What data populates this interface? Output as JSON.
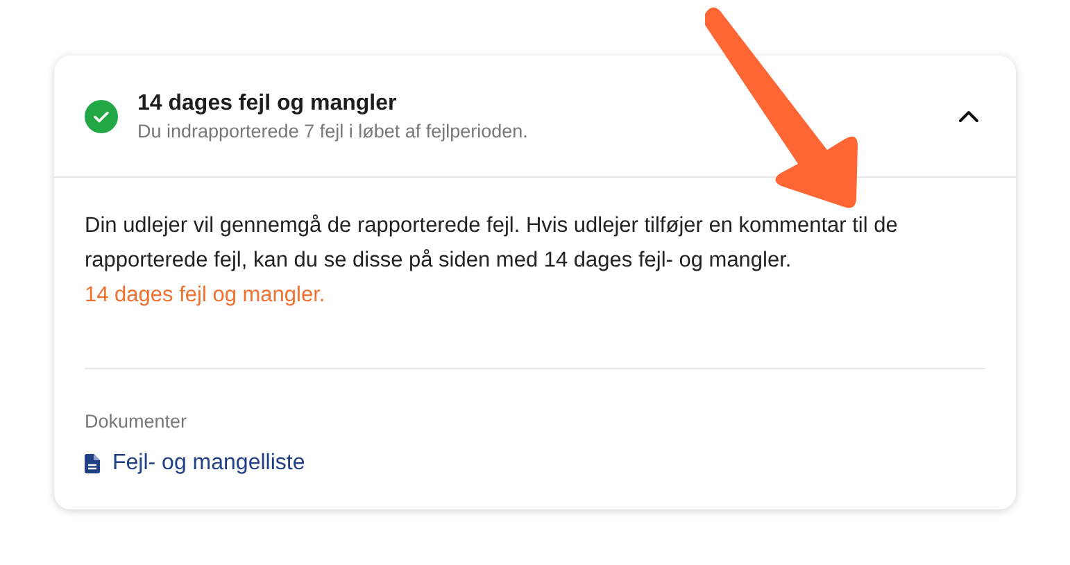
{
  "panel": {
    "title": "14 dages fejl og mangler",
    "subtitle": "Du indrapporterede 7 fejl i løbet af fejlperioden.",
    "complete": true,
    "expanded": true
  },
  "body": {
    "text": "Din udlejer vil gennemgå de rapporterede fejl. Hvis udlejer tilføjer en kommentar til de rapporterede fejl, kan du se disse på siden med 14 dages fejl- og mangler.",
    "link": "14 dages fejl og mangler."
  },
  "documents": {
    "heading": "Dokumenter",
    "items": [
      {
        "label": "Fejl- og mangelliste"
      }
    ]
  },
  "annotation": {
    "kind": "arrow",
    "color": "#ff6633"
  }
}
